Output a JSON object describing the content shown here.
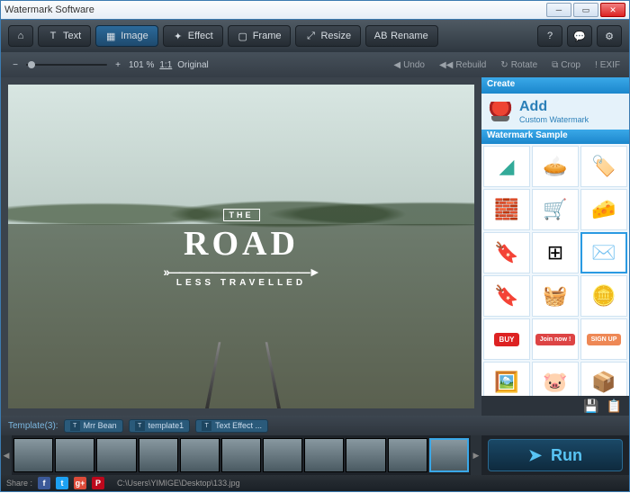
{
  "window": {
    "title": "Watermark Software"
  },
  "toolbar": {
    "home": "⌂",
    "text_label": "Text",
    "image_label": "Image",
    "effect_label": "Effect",
    "frame_label": "Frame",
    "resize_label": "Resize",
    "rename_label": "Rename"
  },
  "zoom": {
    "percent": "101 %",
    "ratio": "1:1",
    "size_label": "Original",
    "undo": "Undo",
    "rebuild": "Rebuild",
    "rotate": "Rotate",
    "crop": "Crop",
    "exif": "EXIF"
  },
  "watermark": {
    "line1": "THE",
    "line2": "ROAD",
    "line3": "LESS TRAVELLED"
  },
  "panel": {
    "create": "Create",
    "add": "Add",
    "add_sub": "Custom Watermark",
    "sample": "Watermark Sample",
    "buy": "BUY",
    "join": "Join now !",
    "signup": "SIGN UP"
  },
  "templates": {
    "label": "Template(3):",
    "items": [
      "Mrr Bean",
      "template1",
      "Text Effect ..."
    ]
  },
  "run": {
    "label": "Run"
  },
  "status": {
    "share": "Share :",
    "path": "C:\\Users\\YIMIGE\\Desktop\\133.jpg"
  }
}
